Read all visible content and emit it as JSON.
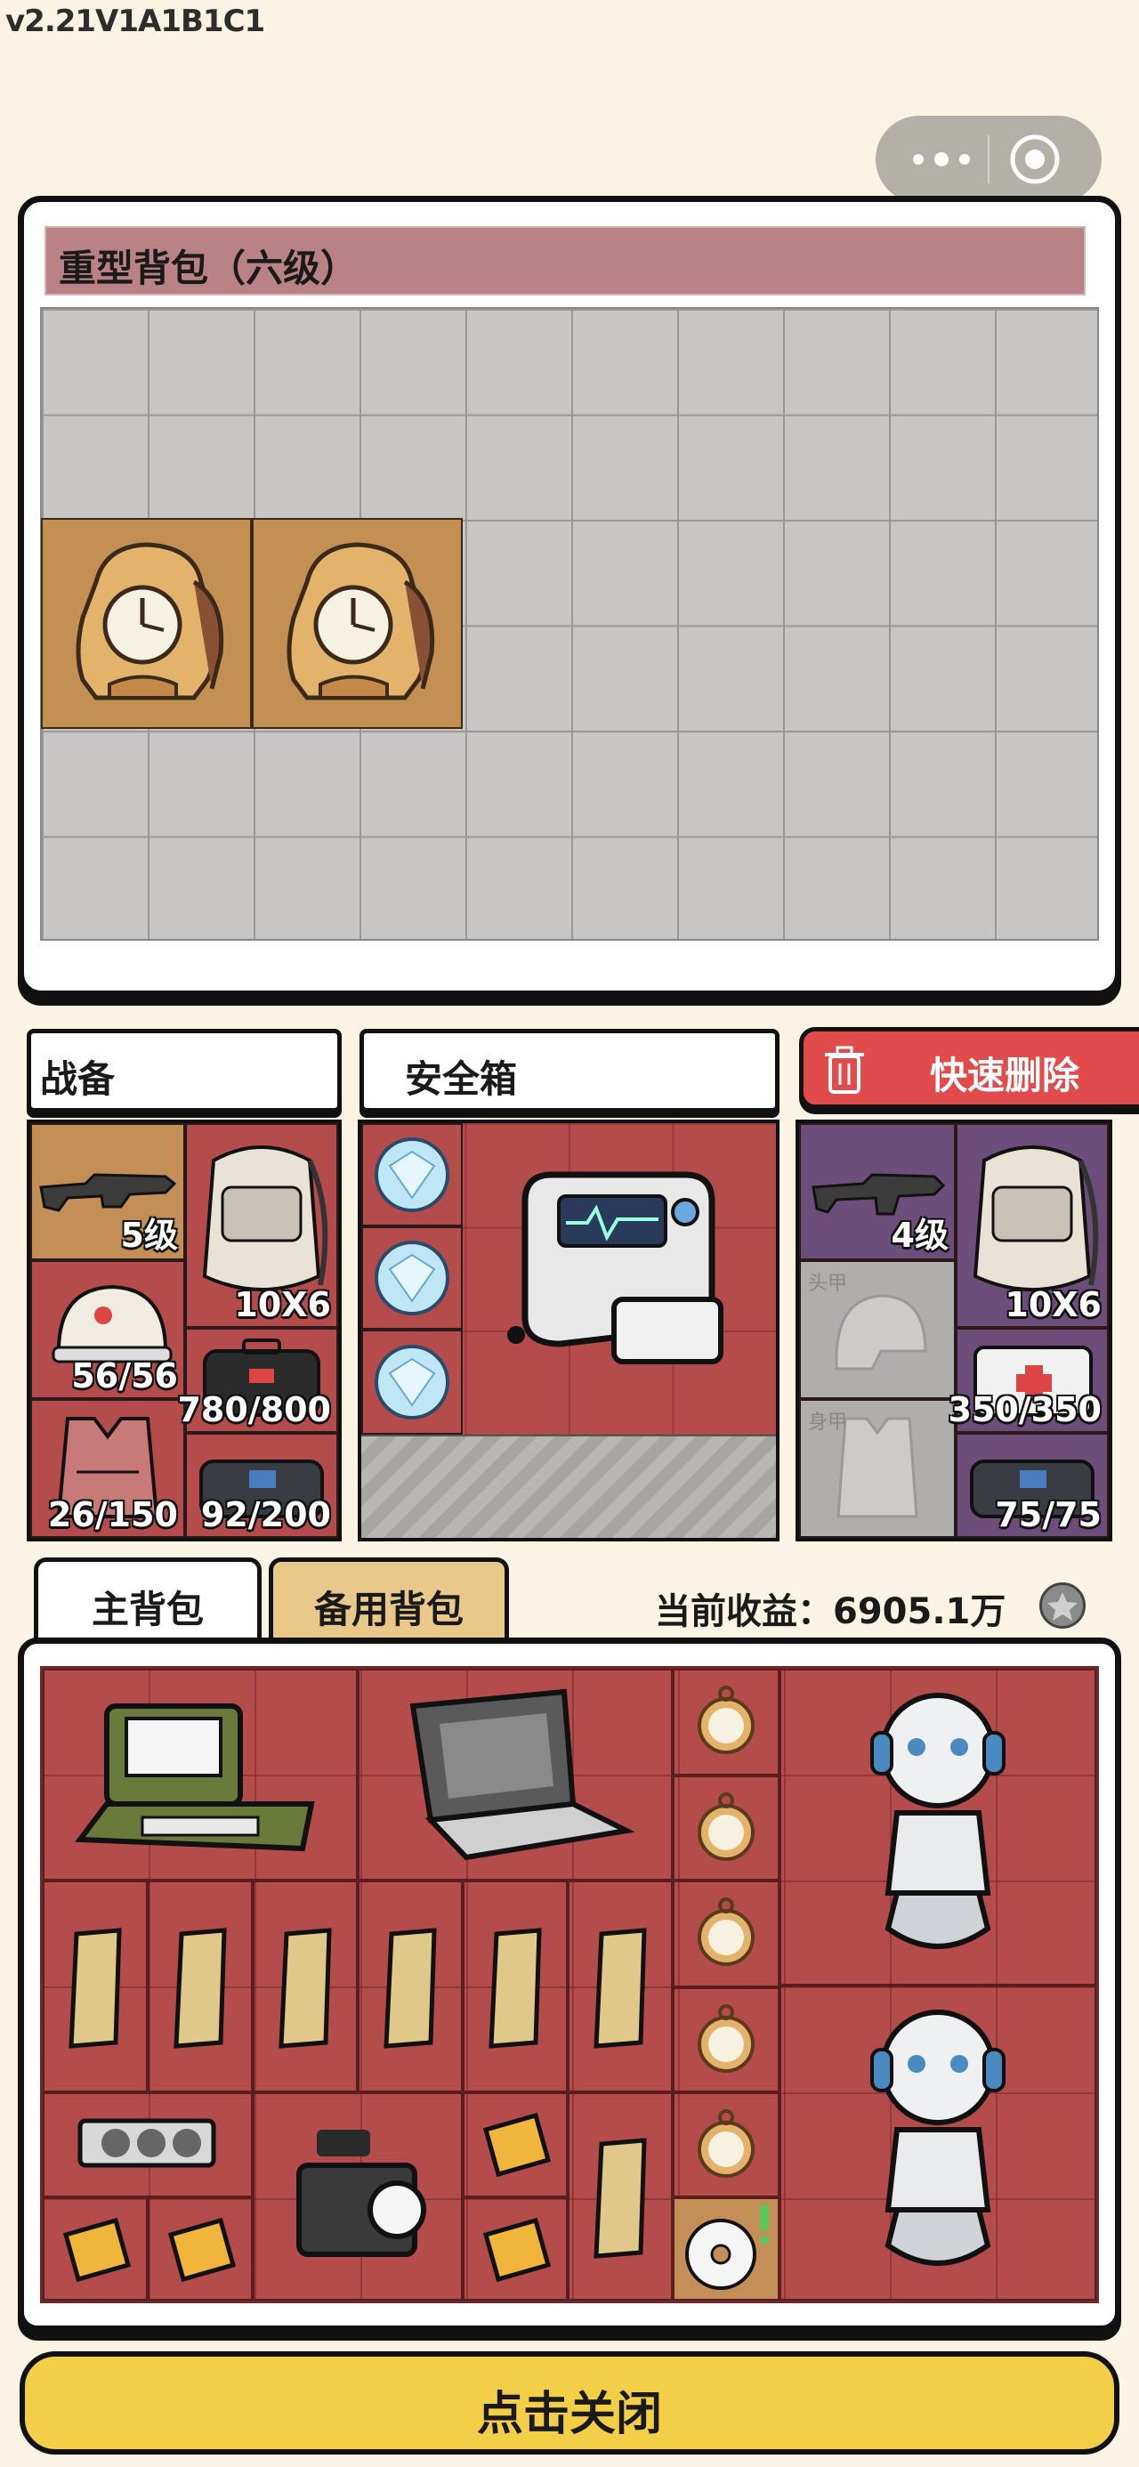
{
  "version": "v2.21V1A1B1C1",
  "capsule": {
    "menu_icon": "more-dots-icon",
    "close_icon": "target-icon"
  },
  "heavy_pack": {
    "title": "重型背包（六级）"
  },
  "gear": {
    "title": "战备",
    "slots": {
      "weapon": "5级",
      "backpack": "10X6",
      "helmet": "56/56",
      "vest": "26/150",
      "medkit": "780/800",
      "bag": "92/200"
    }
  },
  "safe_box": {
    "title": "安全箱"
  },
  "quick_delete": {
    "label": "快速删除"
  },
  "enemy_gear": {
    "slots": {
      "weapon": "4级",
      "backpack": "10X6",
      "head_label": "头甲",
      "body_label": "身甲",
      "medkit": "350/350",
      "bag": "75/75"
    }
  },
  "tabs": {
    "main": "主背包",
    "spare": "备用背包"
  },
  "income": {
    "label": "当前收益：",
    "value": "6905.1万"
  },
  "close_button": "点击关闭",
  "colors": {
    "accent_red": "#b44c4c",
    "button_yellow": "#f3cf47",
    "delete_red": "#e24b4b",
    "title_pink": "#b98284"
  }
}
